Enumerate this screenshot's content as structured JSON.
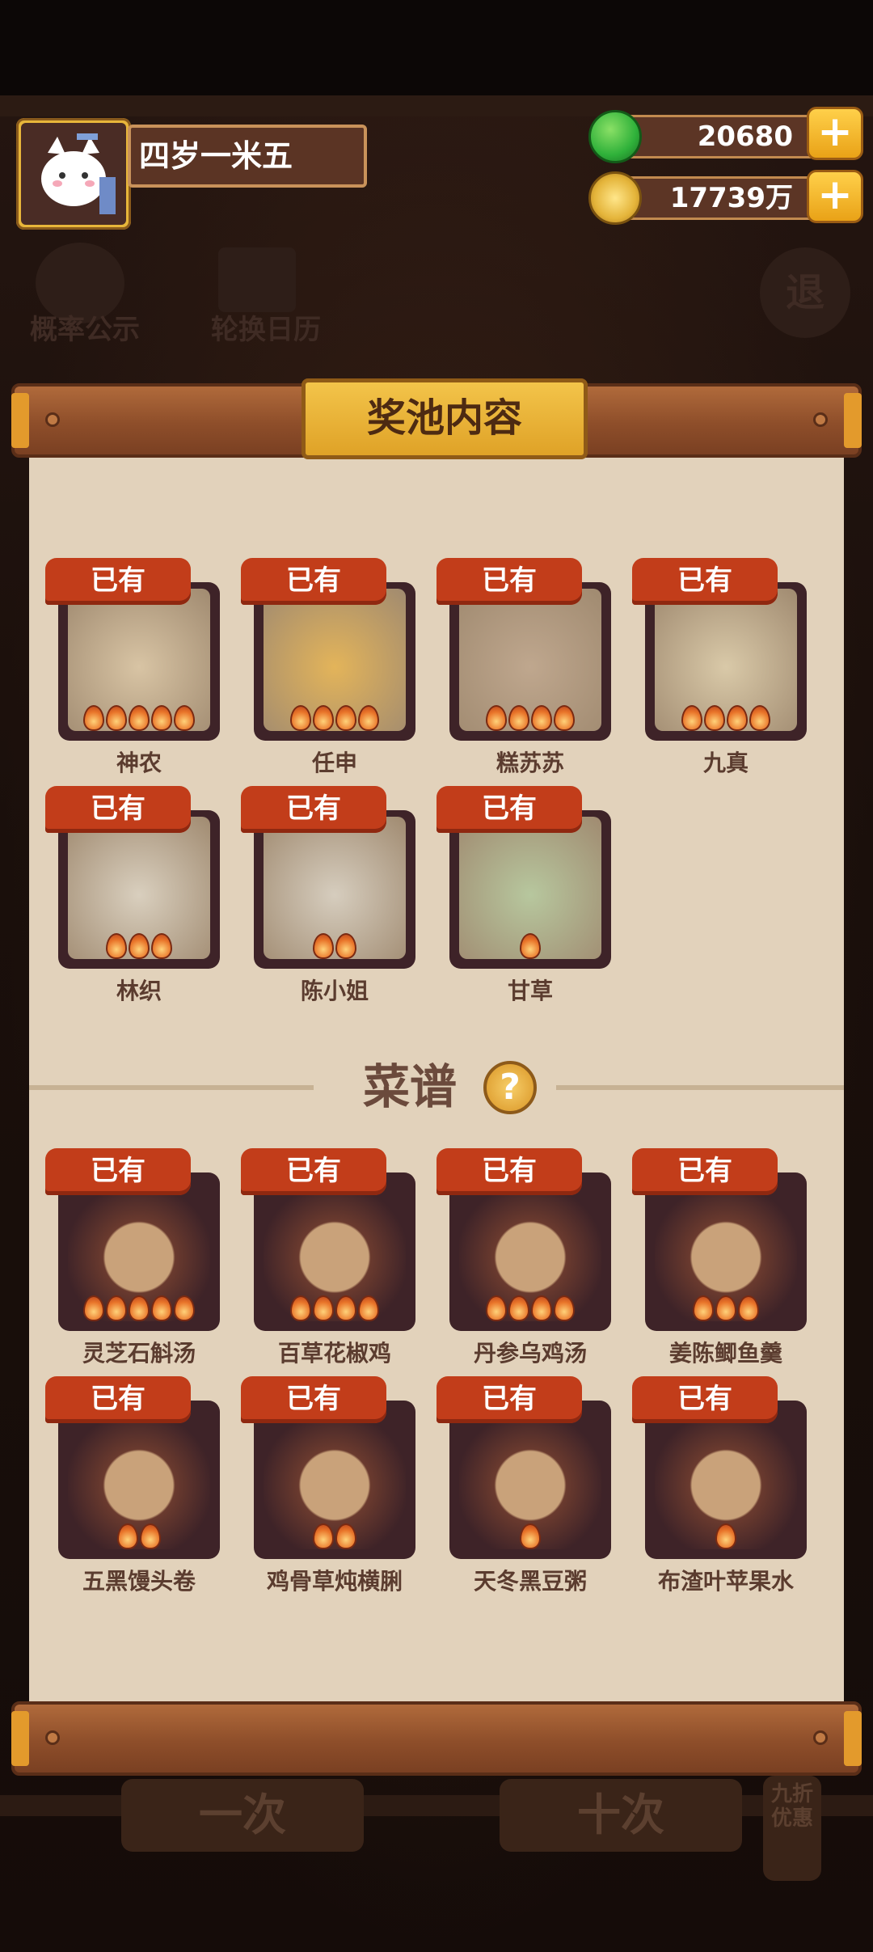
{
  "player": {
    "name": "四岁一米五"
  },
  "resources": {
    "jade": {
      "value": "20680",
      "icon": "green-gem-icon",
      "color": "#2fb13a"
    },
    "coins": {
      "value": "17739万",
      "icon": "coin-icon",
      "color": "#e4b43a"
    }
  },
  "background": {
    "buttons": [
      {
        "label": "概率公示"
      },
      {
        "label": "轮换日历"
      }
    ],
    "exit_label": "退",
    "bottom_left": "一次",
    "bottom_right": "十次",
    "side_badge": "九折优惠"
  },
  "panel": {
    "title": "奖池内容",
    "owned_label": "已有",
    "sections": [
      {
        "title": "",
        "items": [
          {
            "name": "神农",
            "stars": 5,
            "art": "#d8c4a4"
          },
          {
            "name": "任申",
            "stars": 4,
            "art": "#e3b45a"
          },
          {
            "name": "糕苏苏",
            "stars": 4,
            "art": "#bfa78e"
          },
          {
            "name": "九真",
            "stars": 4,
            "art": "#d9c9a8"
          },
          {
            "name": "林织",
            "stars": 3,
            "art": "#d9cfbe"
          },
          {
            "name": "陈小姐",
            "stars": 2,
            "art": "#d6cdbe"
          },
          {
            "name": "甘草",
            "stars": 1,
            "art": "#b7c79e"
          }
        ]
      },
      {
        "title": "菜谱",
        "items": [
          {
            "name": "灵芝石斛汤",
            "stars": 5,
            "art": "#6a3a2e"
          },
          {
            "name": "百草花椒鸡",
            "stars": 4,
            "art": "#6a3a2e"
          },
          {
            "name": "丹参乌鸡汤",
            "stars": 4,
            "art": "#6a3a2e"
          },
          {
            "name": "姜陈鲫鱼羹",
            "stars": 3,
            "art": "#6a3a2e"
          },
          {
            "name": "五黑馒头卷",
            "stars": 2,
            "art": "#6a3a2e"
          },
          {
            "name": "鸡骨草炖横脷",
            "stars": 2,
            "art": "#6a3a2e"
          },
          {
            "name": "天冬黑豆粥",
            "stars": 1,
            "art": "#6a3a2e"
          },
          {
            "name": "布渣叶苹果水",
            "stars": 1,
            "art": "#6a3a2e"
          }
        ]
      }
    ]
  }
}
